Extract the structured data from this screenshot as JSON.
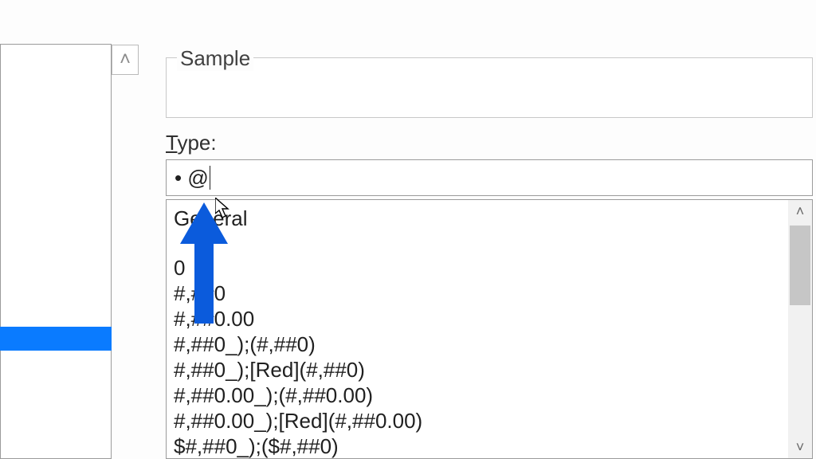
{
  "sample": {
    "label": "Sample"
  },
  "type": {
    "label_prefix": "T",
    "label_rest": "ype:",
    "value": "• @"
  },
  "formats": [
    "General",
    "0",
    "#,##0",
    "#,##0.00",
    "#,##0_);(#,##0)",
    "#,##0_);[Red](#,##0)",
    "#,##0.00_);(#,##0.00)",
    "#,##0.00_);[Red](#,##0.00)",
    "$#,##0_);($#,##0)"
  ],
  "glyphs": {
    "chev_up": "˄",
    "chev_down": "˅",
    "tri_up": "▲",
    "tri_down": "▼"
  }
}
